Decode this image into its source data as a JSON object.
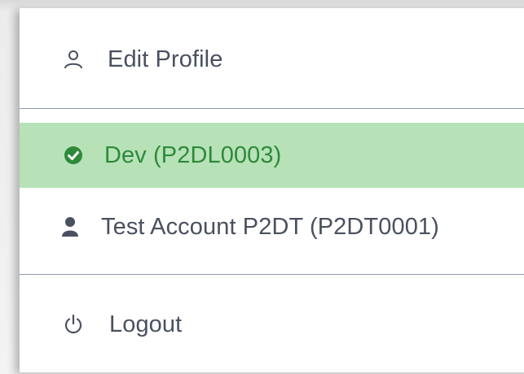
{
  "menu": {
    "items": [
      {
        "label": "Edit Profile",
        "icon": "user-outline-icon"
      },
      {
        "label": "Dev (P2DL0003)",
        "icon": "check-circle-icon",
        "selected": true
      },
      {
        "label": "Test Account P2DT (P2DT0001)",
        "icon": "user-solid-icon"
      },
      {
        "label": "Logout",
        "icon": "power-icon"
      }
    ]
  },
  "colors": {
    "selected_bg": "#b7e2b8",
    "selected_text": "#2e8a3b",
    "text": "#4a5060",
    "divider": "#8f9aae"
  }
}
